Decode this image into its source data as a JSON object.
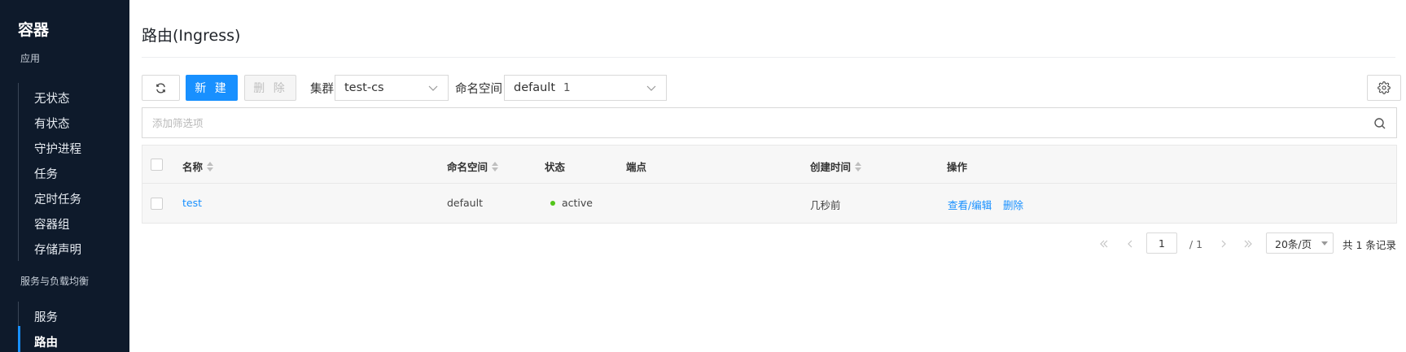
{
  "sidebar": {
    "title": "容器",
    "groups": [
      {
        "label": "应用",
        "items": [
          "无状态",
          "有状态",
          "守护进程",
          "任务",
          "定时任务",
          "容器组",
          "存储声明"
        ]
      },
      {
        "label": "服务与负载均衡",
        "items": [
          "服务",
          "路由"
        ]
      }
    ],
    "active_item": "路由",
    "colors": {
      "background": "#0e1a2b",
      "active_bar": "#1890ff"
    }
  },
  "page": {
    "title": "路由(Ingress)"
  },
  "toolbar": {
    "refresh_icon": "refresh-icon",
    "new_label": "新 建",
    "delete_label": "删 除",
    "cluster_label": "集群",
    "cluster_value": "test-cs",
    "namespace_label": "命名空间",
    "namespace_value": "default",
    "namespace_count": "1",
    "settings_icon": "gear-icon",
    "accent_color": "#1890ff"
  },
  "filter": {
    "placeholder": "添加筛选项",
    "icon": "search-icon"
  },
  "table": {
    "columns": [
      "名称",
      "命名空间",
      "状态",
      "端点",
      "创建时间",
      "操作"
    ],
    "rows": [
      {
        "name": "test",
        "namespace": "default",
        "status": "active",
        "status_color": "#52c41a",
        "endpoint": "",
        "created": "几秒前",
        "actions": [
          "查看/编辑",
          "删除"
        ]
      }
    ]
  },
  "pagination": {
    "current_page": "1",
    "total_pages": "/ 1",
    "page_size": "20条/页",
    "total": "共 1 条记录"
  }
}
